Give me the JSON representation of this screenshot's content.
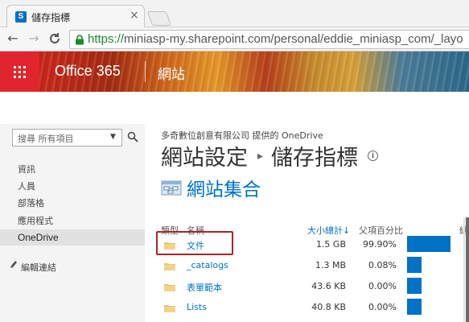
{
  "browser": {
    "tab_title": "儲存指標",
    "tab_close": "×",
    "back": "←",
    "forward": "→",
    "reload": "C",
    "url_protocol": "https://",
    "url_rest": "miniasp-my.sharepoint.com/personal/eddie_miniasp_com/_layo"
  },
  "suitebar": {
    "brand": "Office 365",
    "app": "網站"
  },
  "leftnav": {
    "search_placeholder": "搜尋 所有項目",
    "search_caret": "▼",
    "items": [
      "資訊",
      "人員",
      "部落格",
      "應用程式",
      "OneDrive"
    ],
    "edit_links": "編輯連結"
  },
  "main": {
    "provider": "多奇數位創意有限公司 提供的 OneDrive",
    "breadcrumb_parent": "網站設定",
    "breadcrumb_sep": "▸",
    "page_title": "儲存指標",
    "info": "i",
    "site_collection": "網站集合",
    "columns": {
      "type": "類型",
      "name": "名稱",
      "size": "大小總計↓",
      "percent": "父項百分比",
      "extra": "總"
    },
    "rows": [
      {
        "name": "文件",
        "size": "1.5 GB",
        "percent": "99.90%",
        "bar_fraction": 0.999
      },
      {
        "name": "_catalogs",
        "size": "1.3 MB",
        "percent": "0.08%",
        "bar_fraction": 0.0008
      },
      {
        "name": "表單範本",
        "size": "43.6 KB",
        "percent": "0.00%",
        "bar_fraction": 0.0
      },
      {
        "name": "Lists",
        "size": "40.8 KB",
        "percent": "0.00%",
        "bar_fraction": 0.0
      }
    ]
  },
  "colors": {
    "accent": "#0072c6",
    "suite_red": "#e0262c",
    "highlight": "#a3262a"
  }
}
